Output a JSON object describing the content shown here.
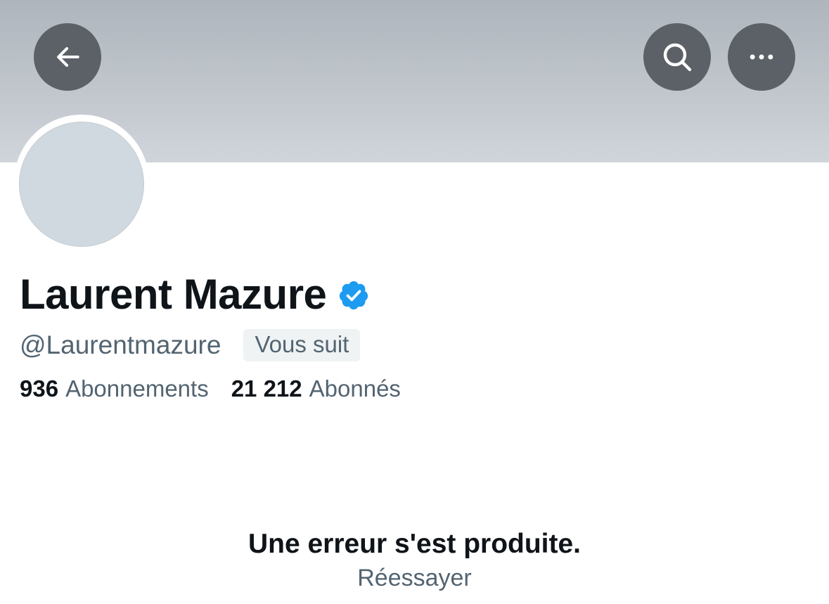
{
  "header": {
    "back_icon": "arrow-left-icon",
    "search_icon": "search-icon",
    "more_icon": "more-horizontal-icon"
  },
  "profile": {
    "name": "Laurent Mazure",
    "verified_icon": "verified-badge-icon",
    "verified_color": "#1d9bf0",
    "handle": "@Laurentmazure",
    "follows_you": "Vous suit",
    "following_count": "936",
    "following_label": "Abonnements",
    "followers_count": "21 212",
    "followers_label": "Abonnés"
  },
  "error": {
    "title": "Une erreur s'est produite.",
    "retry": "Réessayer"
  },
  "colors": {
    "primary_text": "#0f1419",
    "secondary_text": "#536471",
    "header_button_bg": "#5b6166",
    "avatar_placeholder": "#d0d9df"
  }
}
